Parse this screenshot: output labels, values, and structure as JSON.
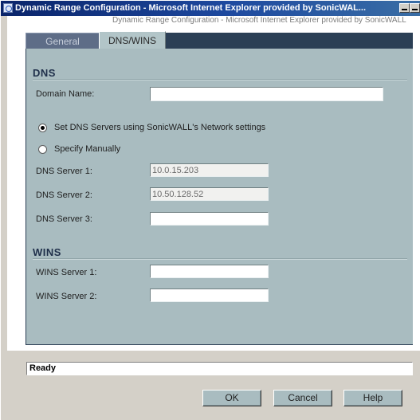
{
  "window": {
    "title": "Dynamic Range Configuration - Microsoft Internet Explorer provided by SonicWAL..."
  },
  "background_title": "Dynamic Range Configuration - Microsoft Internet Explorer provided by SonicWALL",
  "tabs": [
    {
      "label": "General",
      "active": false
    },
    {
      "label": "DNS/WINS",
      "active": true
    }
  ],
  "dns": {
    "section_title": "DNS",
    "domain_name_label": "Domain Name:",
    "domain_name_value": "",
    "radio_network": {
      "label": "Set DNS Servers using SonicWALL's Network settings",
      "checked": true
    },
    "radio_manual": {
      "label": "Specify Manually",
      "checked": false
    },
    "servers": [
      {
        "label": "DNS Server 1:",
        "value": "10.0.15.203"
      },
      {
        "label": "DNS Server 2:",
        "value": "10.50.128.52"
      },
      {
        "label": "DNS Server 3:",
        "value": ""
      }
    ]
  },
  "wins": {
    "section_title": "WINS",
    "servers": [
      {
        "label": "WINS Server 1:",
        "value": ""
      },
      {
        "label": "WINS Server 2:",
        "value": ""
      }
    ]
  },
  "status": {
    "text": "Ready"
  },
  "buttons": {
    "ok": "OK",
    "cancel": "Cancel",
    "help": "Help"
  },
  "colors": {
    "panel": "#a9bcc0",
    "active_tab": "#b2c5c8",
    "inactive_tab": "#5e6d87",
    "title_bar": "#0a246a"
  }
}
